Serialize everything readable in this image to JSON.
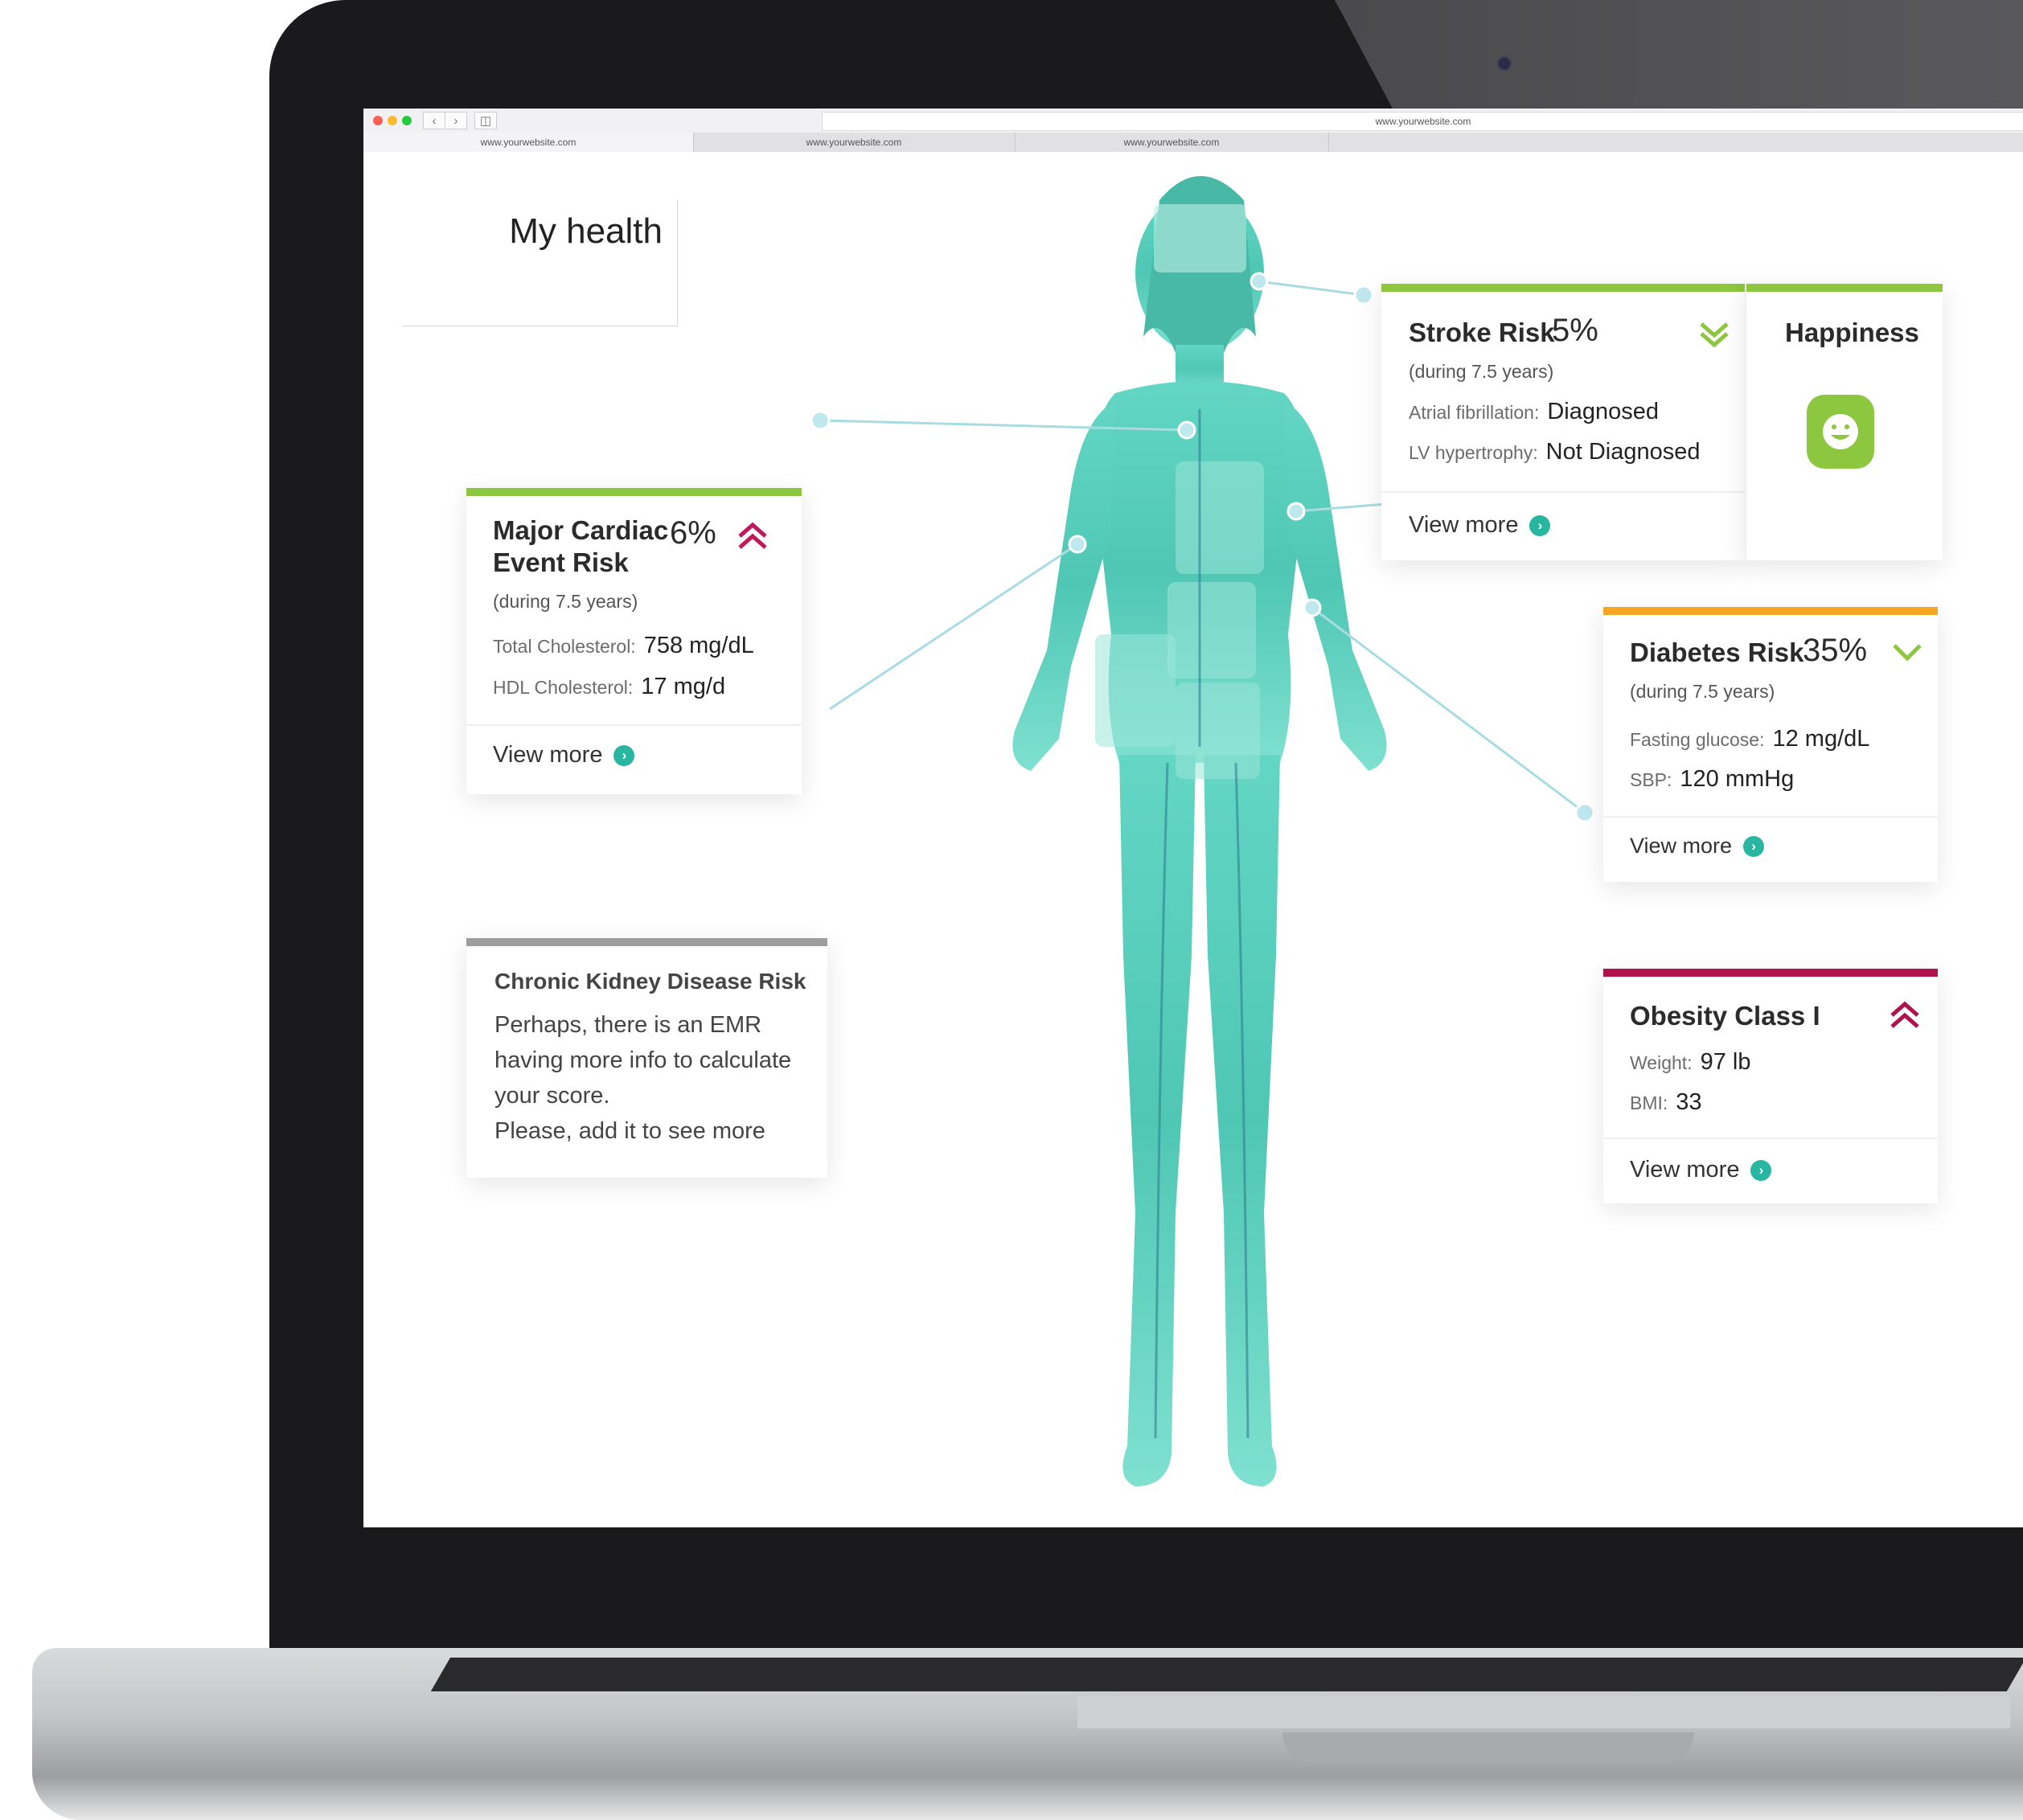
{
  "browser": {
    "url": "www.yourwebsite.com",
    "tabs": [
      "www.yourwebsite.com",
      "www.yourwebsite.com",
      "www.yourwebsite.com"
    ]
  },
  "page": {
    "title": "My health"
  },
  "cards": {
    "stroke": {
      "title": "Stroke Risk",
      "value": "5%",
      "period": "(during 7.5 years)",
      "row1_label": "Atrial fibrillation:",
      "row1_value": "Diagnosed",
      "row2_label": "LV hypertrophy:",
      "row2_value": "Not Diagnosed",
      "link": "View more",
      "trend": "down",
      "accent": "#8dc63f"
    },
    "happiness": {
      "title": "Happiness",
      "icon": "smiley-icon",
      "color": "#8dc63f"
    },
    "cardiac": {
      "title_line1": "Major Cardiac",
      "title_line2": "Event Risk",
      "value": "6%",
      "period": "(during 7.5 years)",
      "row1_label": "Total Cholesterol:",
      "row1_value": "758 mg/dL",
      "row2_label": "HDL Cholesterol:",
      "row2_value": "17 mg/d",
      "link": "View more",
      "trend": "up",
      "accent": "#8dc63f",
      "trend_color": "#c2185b"
    },
    "diabetes": {
      "title": "Diabetes Risk",
      "value": "35%",
      "period": "(during 7.5 years)",
      "row1_label": "Fasting glucose:",
      "row1_value": "12 mg/dL",
      "row2_label": "SBP:",
      "row2_value": "120 mmHg",
      "link": "View more",
      "trend": "down",
      "accent": "#f5a623"
    },
    "ckd": {
      "title": "Chronic Kidney Disease Risk",
      "line1": "Perhaps, there is an EMR",
      "line2": "having more info to calculate",
      "line3": "your score.",
      "line4": "Please, add it to see more",
      "accent": "#9e9e9e"
    },
    "obesity": {
      "title": "Obesity Class I",
      "row1_label": "Weight:",
      "row1_value": "97 lb",
      "row2_label": "BMI:",
      "row2_value": "33",
      "link": "View more",
      "trend": "up",
      "accent": "#b0124e"
    }
  },
  "colors": {
    "body_teal": "#5fd3c0",
    "link_teal": "#29b6a0",
    "connector": "#a9dbe3"
  }
}
